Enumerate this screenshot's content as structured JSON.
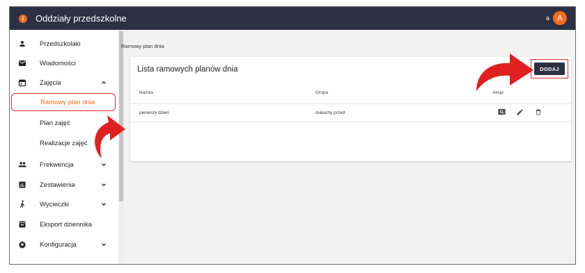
{
  "header": {
    "title": "Oddziały przedszkolne",
    "logo_glyph": "i",
    "user_name": "a",
    "avatar_letter": "A"
  },
  "sidebar": {
    "items": [
      {
        "label": "Przedszkolaki",
        "icon": "person-icon"
      },
      {
        "label": "Wiadomości",
        "icon": "mail-icon"
      },
      {
        "label": "Zajęcia",
        "icon": "calendar-icon",
        "expanded": true
      },
      {
        "label": "Ramowy plan dnia",
        "active": true
      },
      {
        "label": "Plan zajęć"
      },
      {
        "label": "Realizacje zajęć"
      },
      {
        "label": "Frekwencja",
        "icon": "people-icon"
      },
      {
        "label": "Zestawienia",
        "icon": "chart-icon"
      },
      {
        "label": "Wycieczki",
        "icon": "walk-icon"
      },
      {
        "label": "Eksport dziennika",
        "icon": "archive-icon"
      },
      {
        "label": "Konfiguracja",
        "icon": "gear-icon"
      }
    ]
  },
  "main": {
    "breadcrumb": "Ramowy plan dnia",
    "card": {
      "title": "Lista ramowych planów dnia",
      "add_button": "DODAJ",
      "columns": [
        "Nazwa",
        "Grupa",
        "Akcje"
      ],
      "rows": [
        {
          "name": "pierwszy dzień",
          "group": "maluchy przed"
        }
      ]
    }
  },
  "colors": {
    "topbar": "#2b3042",
    "accent": "#f36b1c",
    "highlight_border": "#e02d2d",
    "arrow": "#e02020"
  }
}
